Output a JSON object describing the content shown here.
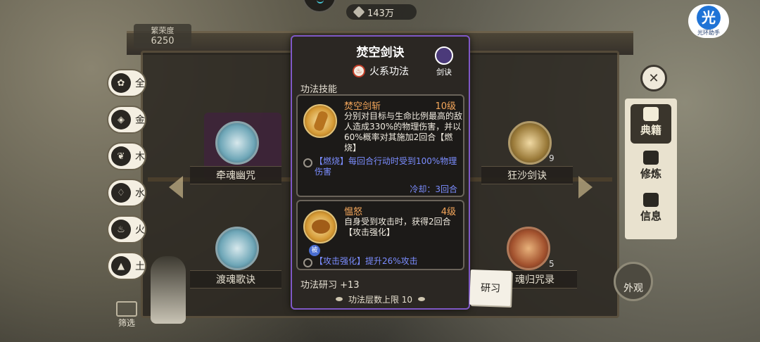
{
  "top": {
    "currency_value": "143万",
    "prosperity_label": "繁荣度",
    "prosperity_value": "6250",
    "helper_big": "光",
    "helper_small": "光环助手"
  },
  "elements": [
    {
      "label": "全",
      "glyph": "✿"
    },
    {
      "label": "金",
      "glyph": "◈"
    },
    {
      "label": "木",
      "glyph": "❦"
    },
    {
      "label": "水",
      "glyph": "♢"
    },
    {
      "label": "火",
      "glyph": "♨"
    },
    {
      "label": "土",
      "glyph": "▲"
    }
  ],
  "filter_label": "筛选",
  "hall_skills": [
    {
      "name": "牵魂幽咒",
      "count": ""
    },
    {
      "name": "狂沙剑诀",
      "count": "9"
    },
    {
      "name": "渡魂歌诀",
      "count": ""
    },
    {
      "name": "魂归咒录",
      "count": "5"
    }
  ],
  "side_tabs": [
    "典籍",
    "修炼",
    "信息"
  ],
  "appearance_label": "外观",
  "popup": {
    "title": "焚空剑诀",
    "type_label": "火系功法",
    "sword_tag": "剑诀",
    "section_title": "功法技能",
    "skills": [
      {
        "name": "焚空剑斩",
        "level": "10级",
        "description": "分别对目标与生命比例最高的敌人造成330%的物理伤害，并以60%概率对其施加2回合【燃烧】",
        "effect": "【燃烧】每回合行动时受到100%物理伤害",
        "cooldown": "冷却：3回合"
      },
      {
        "name": "愠怒",
        "level": "4级",
        "passive_badge": "被",
        "description": "自身受到攻击时，获得2回合【攻击强化】",
        "effect": "【攻击强化】提升26%攻击"
      }
    ],
    "research_text": "功法研习 +13",
    "footer_text": "功法层数上限 10"
  },
  "study_button": "研习",
  "colors": {
    "popup_border": "#7f58c6",
    "skill_name": "#f5a75b",
    "effect_text": "#7b8dff"
  }
}
